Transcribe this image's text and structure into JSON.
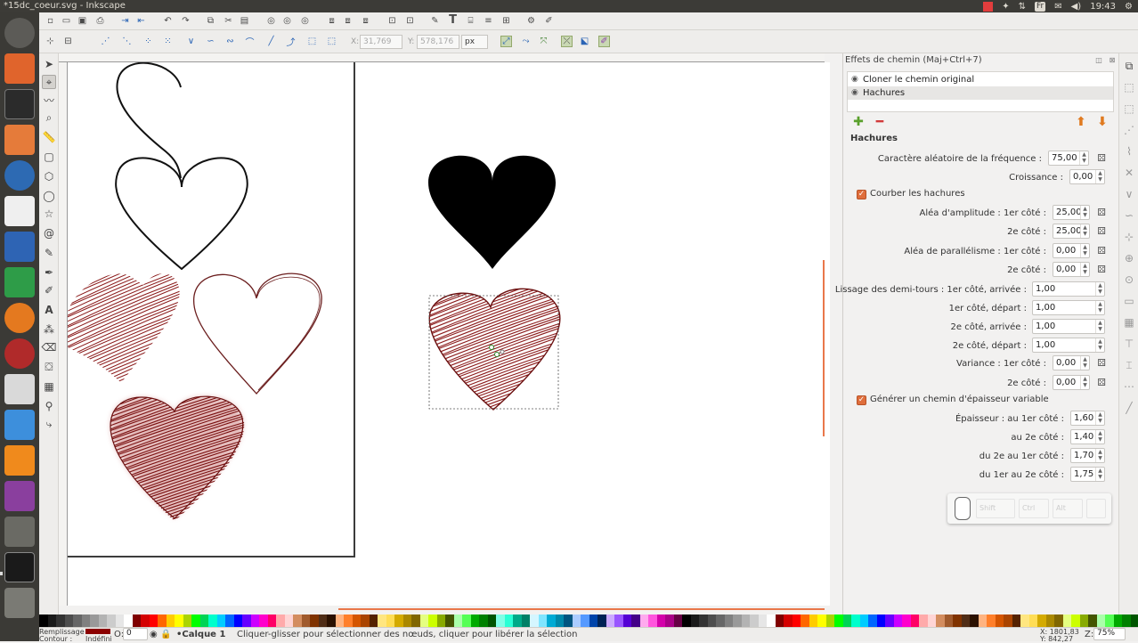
{
  "window": {
    "title": "*15dc_coeur.svg - Inkscape"
  },
  "tray": {
    "lang": "Fr",
    "time": "19:43"
  },
  "toolbar2": {
    "x_label": "X:",
    "x_value": "31,769",
    "y_label": "Y:",
    "y_value": "578,176",
    "unit": "px"
  },
  "dock": {
    "title": "Effets de chemin (Maj+Ctrl+7)",
    "effects": [
      {
        "label": "Cloner le chemin original"
      },
      {
        "label": "Hachures"
      }
    ],
    "section_title": "Hachures",
    "params": {
      "freq_random": {
        "label": "Caractère aléatoire de la fréquence :",
        "value": "75,00"
      },
      "growth": {
        "label": "Croissance :",
        "value": "0,00"
      },
      "bend": {
        "label": "Courber les hachures"
      },
      "amp_1": {
        "label": "Aléa d'amplitude : 1er côté :",
        "value": "25,00"
      },
      "amp_2": {
        "label": "2e côté :",
        "value": "25,00"
      },
      "par_1": {
        "label": "Aléa de parallélisme : 1er côté :",
        "value": "0,00"
      },
      "par_2": {
        "label": "2e côté :",
        "value": "0,00"
      },
      "smooth_1a": {
        "label": "Lissage des demi-tours : 1er côté, arrivée :",
        "value": "1,00"
      },
      "smooth_1d": {
        "label": "1er côté, départ :",
        "value": "1,00"
      },
      "smooth_2a": {
        "label": "2e côté, arrivée :",
        "value": "1,00"
      },
      "smooth_2d": {
        "label": "2e côté, départ :",
        "value": "1,00"
      },
      "var_1": {
        "label": "Variance : 1er côté :",
        "value": "0,00"
      },
      "var_2": {
        "label": "2e côté :",
        "value": "0,00"
      },
      "thick": {
        "label": "Générer un chemin d'épaisseur variable"
      },
      "th_1": {
        "label": "Épaisseur : au 1er côté :",
        "value": "1,60"
      },
      "th_2": {
        "label": "au 2e côté :",
        "value": "1,40"
      },
      "th_21": {
        "label": "du 2e au 1er côté :",
        "value": "1,70"
      },
      "th_12": {
        "label": "du 1er au 2e côté :",
        "value": "1,75"
      }
    }
  },
  "keys": {
    "shift": "Shift",
    "ctrl": "Ctrl",
    "alt": "Alt"
  },
  "status": {
    "fill_label": "Remplissage :",
    "stroke_label": "Contour :",
    "stroke_value": "Indéfini",
    "opacity_label": "O:",
    "opacity_value": "0",
    "layer": "•Calque 1",
    "message": "Cliquer-glisser pour sélectionner des nœuds, cliquer pour libérer la sélection",
    "x_readout": "X: 1801,83",
    "y_readout": "Y:   842,27",
    "zoom_label": "Z:",
    "zoom_value": "75%"
  },
  "colors": {
    "accent": "#e9774a",
    "fill_swatch": "#8b0000",
    "hatch": "#8b1a1a"
  }
}
